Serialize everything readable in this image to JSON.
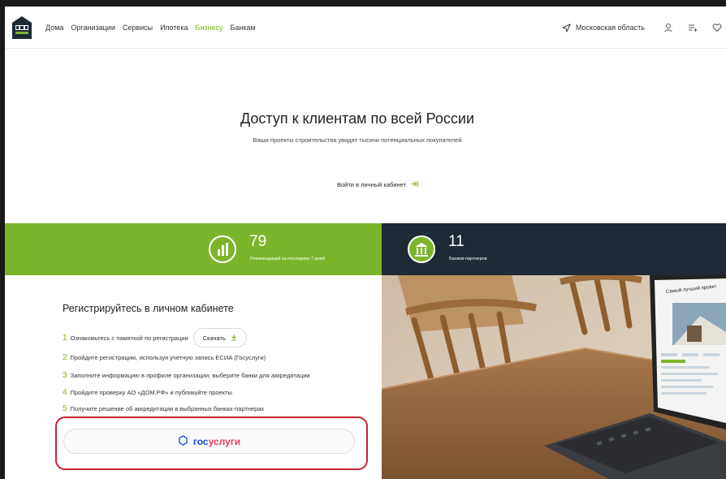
{
  "header": {
    "logo_text": "ДОМ",
    "nav": [
      {
        "label": "Дома",
        "active": false
      },
      {
        "label": "Организации",
        "active": false
      },
      {
        "label": "Сервисы",
        "active": false
      },
      {
        "label": "Ипотека",
        "active": false
      },
      {
        "label": "Бизнесу",
        "active": true
      },
      {
        "label": "Банкам",
        "active": false
      }
    ],
    "location": "Московская область",
    "icons": [
      "location-arrow-icon",
      "user-icon",
      "compare-icon",
      "heart-icon"
    ]
  },
  "hero": {
    "title": "Доступ к клиентам по всей России",
    "subtitle": "Ваши проекты строительства увидят тысячи потенциальных покупателей",
    "login_label": "Войти в личный кабинет"
  },
  "stats": [
    {
      "value": "79",
      "label": "Рекомендаций за последние 7 дней",
      "icon": "chart-bars-icon",
      "color": "#7cb52c"
    },
    {
      "value": "11",
      "label": "Банков-партнеров",
      "icon": "bank-icon",
      "color": "#1e2a36"
    }
  ],
  "registration": {
    "title": "Регистрируйтесь в личном кабинете",
    "steps": [
      {
        "num": "1",
        "text": "Ознакомьтесь с памяткой по регистрации"
      },
      {
        "num": "2",
        "text": "Пройдите регистрацию, используя учетную запись ЕСИА (Госуслуги)"
      },
      {
        "num": "3",
        "text": "Заполните информацию в профиле организации, выберите банки для аккредитации"
      },
      {
        "num": "4",
        "text": "Пройдите проверку АО «ДОМ.РФ» и публикуйте проекты"
      },
      {
        "num": "5",
        "text": "Получите решение об аккредитации в выбранных банках-партнерах"
      }
    ],
    "download_label": "Скачать",
    "gosuslugi_part1": "гос",
    "gosuslugi_part2": "услуги"
  },
  "photo": {
    "laptop_screen_title": "Самый лучший проект"
  },
  "colors": {
    "accent_green": "#7cb52c",
    "dark_navy": "#1e2a36",
    "highlight_red": "#d0202d",
    "gos_blue": "#0d4cd3",
    "gos_red": "#ee3f58"
  }
}
